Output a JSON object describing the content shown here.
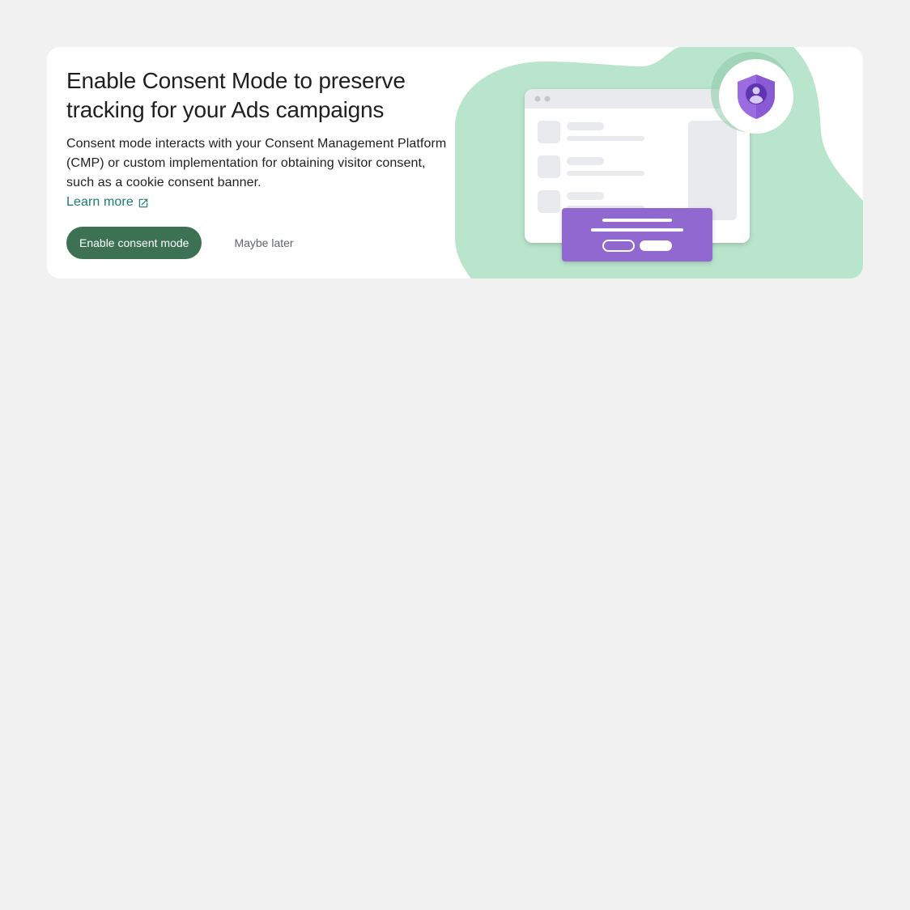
{
  "banner": {
    "title": "Enable Consent Mode to preserve tracking for your Ads campaigns",
    "description": "Consent mode interacts with your Consent Management Platform (CMP) or custom implementation for obtaining visitor consent, such as a cookie consent banner.",
    "learn_more_label": "Learn more",
    "learn_more_icon": "open-in-new-icon",
    "primary_button_label": "Enable consent mode",
    "secondary_button_label": "Maybe later"
  },
  "illustration": {
    "icon": "shield-person-icon"
  },
  "colors": {
    "page_background": "#f1f1f1",
    "card_background": "#ffffff",
    "primary_button": "#3c7153",
    "link": "#1b7a6e",
    "blob": "#b8e5cb",
    "consent_banner": "#9068d0",
    "shield": "#9a6ce0"
  }
}
